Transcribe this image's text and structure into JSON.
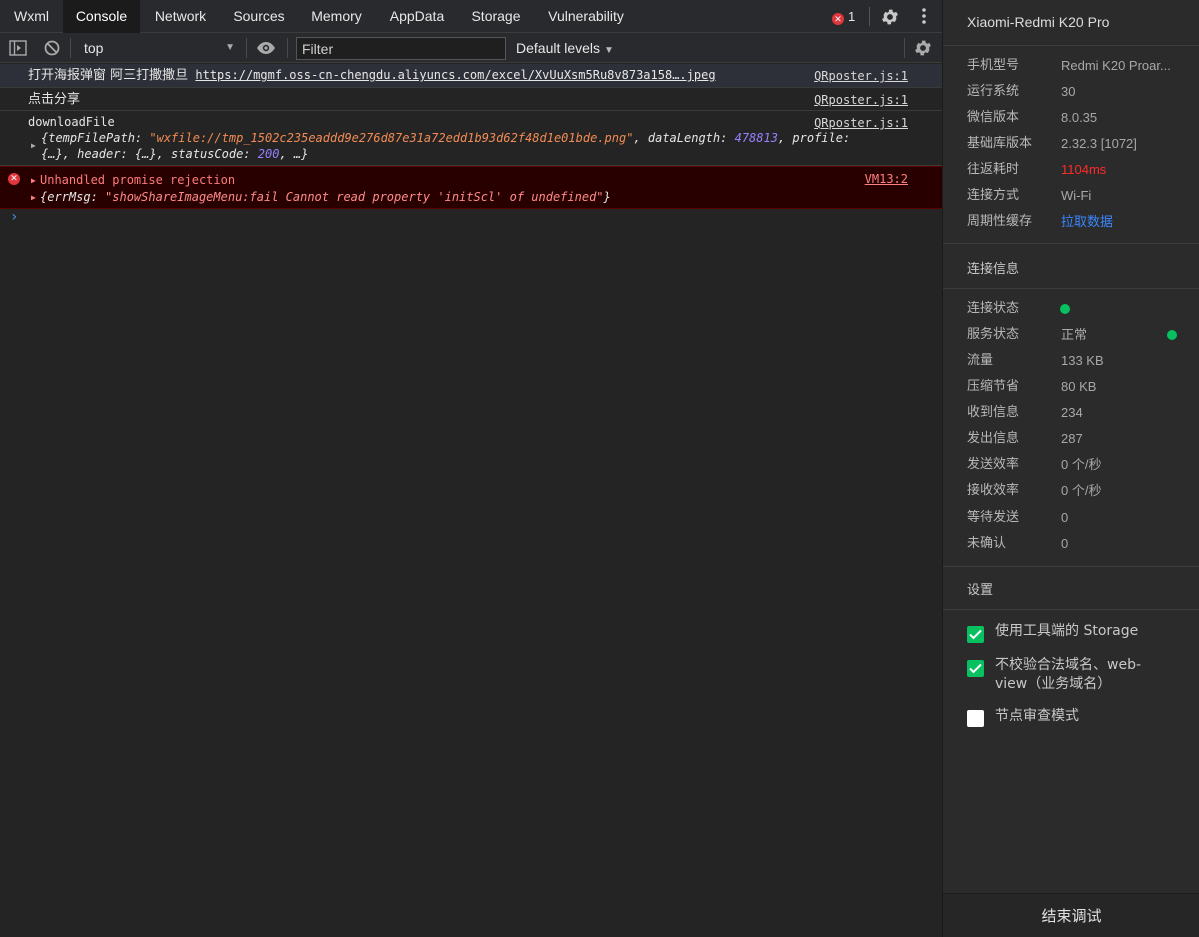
{
  "tabs": [
    {
      "label": "Wxml",
      "active": false
    },
    {
      "label": "Console",
      "active": true
    },
    {
      "label": "Network",
      "active": false
    },
    {
      "label": "Sources",
      "active": false
    },
    {
      "label": "Memory",
      "active": false
    },
    {
      "label": "AppData",
      "active": false
    },
    {
      "label": "Storage",
      "active": false
    },
    {
      "label": "Vulnerability",
      "active": false
    }
  ],
  "error_count": "1",
  "toolbar": {
    "context": "top",
    "filter_placeholder": "Filter",
    "levels": "Default levels"
  },
  "console": {
    "msg1": {
      "text": "打开海报弹窗 阿三打撒撒旦",
      "link": "https://mgmf.oss-cn-chengdu.aliyuncs.com/excel/XvUuXsm5Ru8v873a158….jpeg",
      "source": "QRposter.js:1"
    },
    "msg2": {
      "text": "点击分享",
      "source": "QRposter.js:1"
    },
    "msg3": {
      "text": "downloadFile",
      "source": "QRposter.js:1",
      "k_tempFilePath": "{tempFilePath: ",
      "v_tempFilePath": "\"wxfile://tmp_1502c235eaddd9e276d87e31a72edd1b93d62f48d1e01bde.png\"",
      "k_dataLength": ", dataLength: ",
      "v_dataLength": "478813",
      "k_profile": ", profile:",
      "line3_a": "{…}, header: {…}, statusCode: ",
      "v_statusCode": "200",
      "line3_b": ", …}"
    },
    "error": {
      "title": "Unhandled promise rejection",
      "source": "VM13:2",
      "k_errMsg": "{errMsg: ",
      "v_errMsg": "\"showShareImageMenu:fail Cannot read property 'initScl' of undefined\"",
      "close": "}"
    },
    "prompt": "›"
  },
  "panel": {
    "device": "Xiaomi-Redmi K20 Pro",
    "info": [
      {
        "label": "手机型号",
        "value": "Redmi K20 Proar..."
      },
      {
        "label": "运行系统",
        "value": "30"
      },
      {
        "label": "微信版本",
        "value": "8.0.35"
      },
      {
        "label": "基础库版本",
        "value": "2.32.3 [1072]"
      },
      {
        "label": "往返耗时",
        "value": "1104ms"
      },
      {
        "label": "连接方式",
        "value": "Wi-Fi"
      },
      {
        "label": "周期性缓存",
        "value": "拉取数据"
      }
    ],
    "connection_title": "连接信息",
    "connection": [
      {
        "label": "连接状态",
        "value": ""
      },
      {
        "label": "服务状态",
        "value": "正常"
      },
      {
        "label": "流量",
        "value": "133 KB"
      },
      {
        "label": "压缩节省",
        "value": "80 KB"
      },
      {
        "label": "收到信息",
        "value": "234"
      },
      {
        "label": "发出信息",
        "value": "287"
      },
      {
        "label": "发送效率",
        "value": "0 个/秒"
      },
      {
        "label": "接收效率",
        "value": "0 个/秒"
      },
      {
        "label": "等待发送",
        "value": "0"
      },
      {
        "label": "未确认",
        "value": "0"
      }
    ],
    "settings_title": "设置",
    "settings": [
      {
        "label": "使用工具端的 Storage",
        "checked": true
      },
      {
        "label": "不校验合法域名、web-view（业务域名）",
        "checked": true
      },
      {
        "label": "节点审查模式",
        "checked": false
      }
    ],
    "end_button": "结束调试",
    "colors": {
      "accent_green": "#07c160",
      "error_red": "#ff2a2a",
      "link_blue": "#3a86ff"
    }
  }
}
